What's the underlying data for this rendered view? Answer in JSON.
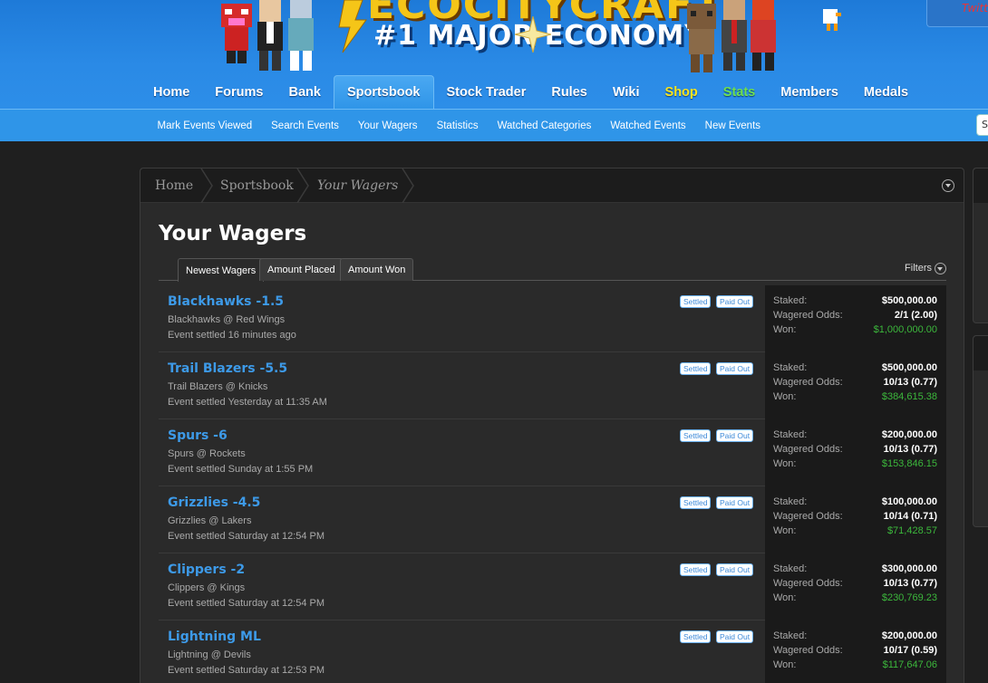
{
  "brand": {
    "title": "ECOCITYCRAFT",
    "tagline": "#1 MAJOR   ECONOMY",
    "twitter": "Twitt",
    "colors": {
      "header": "#2a8ae6",
      "subnav": "#2f95e8",
      "link": "#3d9ae8",
      "won": "#3cb83c"
    }
  },
  "main_nav": [
    "Home",
    "Forums",
    "Bank",
    "Sportsbook",
    "Stock Trader",
    "Rules",
    "Wiki",
    "Shop",
    "Stats",
    "Members",
    "Medals"
  ],
  "main_nav_active": "Sportsbook",
  "sub_nav": [
    "Mark Events Viewed",
    "Search Events",
    "Your Wagers",
    "Statistics",
    "Watched Categories",
    "Watched Events",
    "New Events"
  ],
  "search_stub": "S",
  "breadcrumb": [
    "Home",
    "Sportsbook",
    "Your Wagers"
  ],
  "page_title": "Your Wagers",
  "tabs": [
    "Newest Wagers",
    "Amount Placed",
    "Amount Won"
  ],
  "filters_label": "Filters",
  "labels": {
    "staked": "Staked:",
    "odds": "Wagered Odds:",
    "won": "Won:",
    "settled_badge": "Settled",
    "paid_badge": "Paid Out"
  },
  "wagers": [
    {
      "title": "Blackhawks -1.5",
      "match": "Blackhawks @ Red Wings",
      "settled": "Event settled 16 minutes ago",
      "staked": "$500,000.00",
      "odds": "2/1 (2.00)",
      "won": "$1,000,000.00"
    },
    {
      "title": "Trail Blazers -5.5",
      "match": "Trail Blazers @ Knicks",
      "settled": "Event settled Yesterday at 11:35 AM",
      "staked": "$500,000.00",
      "odds": "10/13 (0.77)",
      "won": "$384,615.38"
    },
    {
      "title": "Spurs -6",
      "match": "Spurs @ Rockets",
      "settled": "Event settled Sunday at 1:55 PM",
      "staked": "$200,000.00",
      "odds": "10/13 (0.77)",
      "won": "$153,846.15"
    },
    {
      "title": "Grizzlies -4.5",
      "match": "Grizzlies @ Lakers",
      "settled": "Event settled Saturday at 12:54 PM",
      "staked": "$100,000.00",
      "odds": "10/14 (0.71)",
      "won": "$71,428.57"
    },
    {
      "title": "Clippers -2",
      "match": "Clippers @ Kings",
      "settled": "Event settled Saturday at 12:54 PM",
      "staked": "$300,000.00",
      "odds": "10/13 (0.77)",
      "won": "$230,769.23"
    },
    {
      "title": "Lightning ML",
      "match": "Lightning @ Devils",
      "settled": "Event settled Saturday at 12:53 PM",
      "staked": "$200,000.00",
      "odds": "10/17 (0.59)",
      "won": "$117,647.06"
    }
  ]
}
